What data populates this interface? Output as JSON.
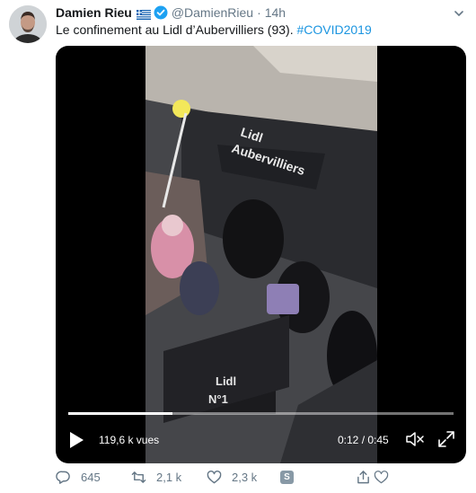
{
  "author": {
    "name": "Damien Rieu",
    "handle": "@DamienRieu",
    "separator": "·",
    "time": "14h",
    "flag_icon": "greek-flag-icon",
    "verified_icon": "verified-badge-icon"
  },
  "tweet": {
    "text": "Le confinement au Lidl d’Aubervilliers (93). ",
    "hashtag": "#COVID2019"
  },
  "video": {
    "views": "119,6 k vues",
    "timecode": "0:12 / 0:45",
    "progress": 0.27,
    "sign_line1": "Lidl",
    "sign_line2": "Aubervilliers",
    "counter_line1": "Lidl",
    "counter_line2": "N°1"
  },
  "actions": {
    "replies": "645",
    "retweets": "2,1 k",
    "likes": "2,3 k",
    "s_label": "S"
  },
  "colors": {
    "link": "#1b95e0",
    "muted": "#657786",
    "verified": "#1da1f2"
  }
}
